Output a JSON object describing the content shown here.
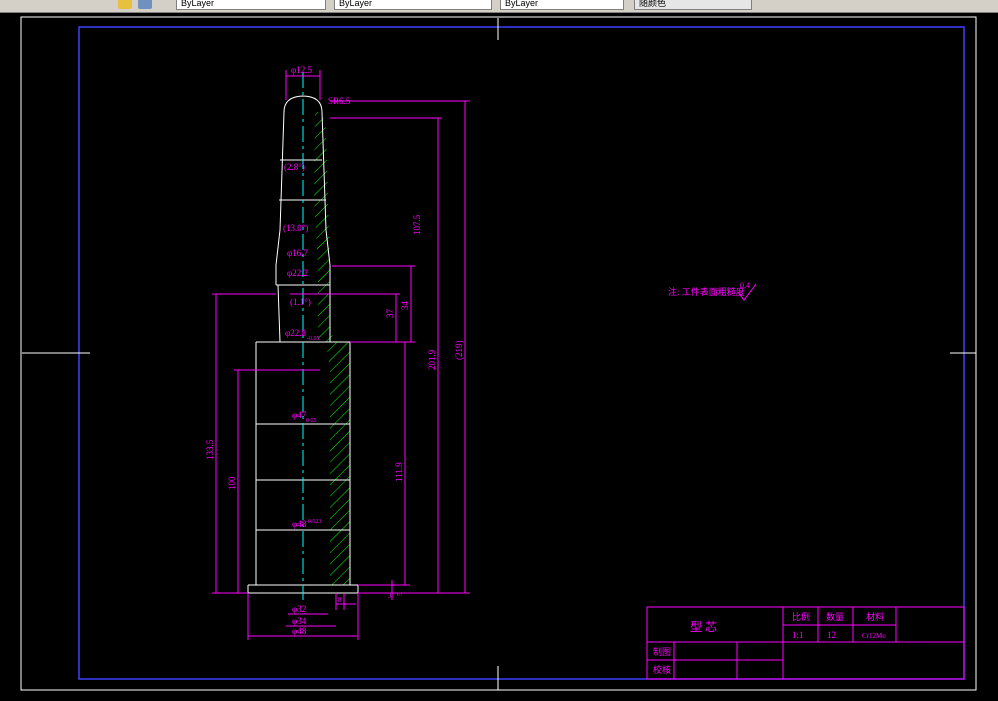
{
  "toolbar": {
    "layer_dropdown": "ByLayer",
    "linetype_dropdown": "ByLayer",
    "lineweight_dropdown": "ByLayer",
    "plotstyle_dropdown": "随颜色"
  },
  "drawing": {
    "note": "注: 工件表面粗糙度",
    "roughness": "0.4",
    "dims": {
      "d_top": "φ12.5",
      "sr": "SR6.5",
      "ang1": "(2.8°)",
      "ang2": "(13.0°)",
      "d16": "φ16.7",
      "d22a": "φ22.2",
      "ang3": "(1.1°)",
      "d22b": "φ22.8",
      "tol1": "-0.05",
      "d47": "φ47",
      "tol2": "0.05",
      "d48": "φ48",
      "tol3": "-0.023",
      "d32": "φ32",
      "d34": "φ34",
      "d48b": "φ48",
      "v107": "107.5",
      "v37": "37",
      "v34": "34",
      "v201": "201.9",
      "v219": "(219)",
      "v133": "133.5",
      "v100": "100",
      "v111": "111.9",
      "v3": "3",
      "v5": "5",
      "v8": "8"
    },
    "title_block": {
      "part_name": "型  芯",
      "h_scale": "比例",
      "h_qty": "数量",
      "h_material": "材料",
      "scale": "1:1",
      "qty": "12",
      "material": "Cr12Mo",
      "drawn": "制图",
      "checked": "校核"
    }
  },
  "colors": {
    "magenta": "#ff00ff",
    "blue": "#0000ff",
    "white": "#ffffff",
    "cyan": "#00ffff",
    "green": "#00ff00"
  }
}
